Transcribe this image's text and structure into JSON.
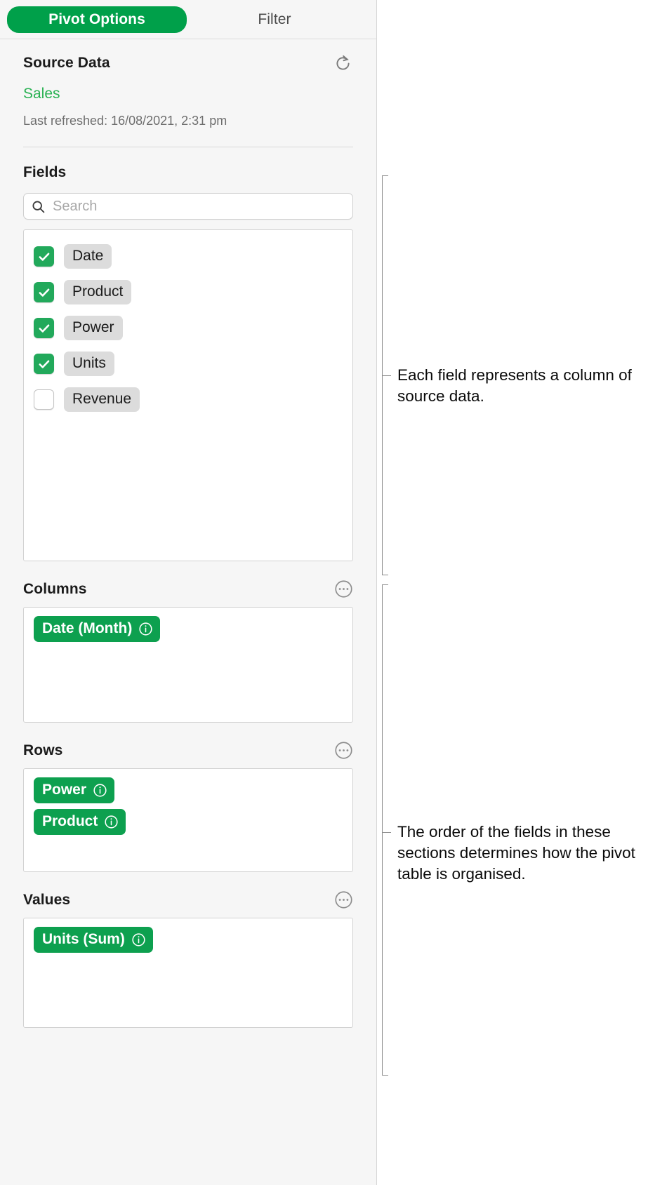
{
  "window": {
    "title": "Pivot Options"
  },
  "tabs": [
    {
      "label": "Pivot Options",
      "active": true
    },
    {
      "label": "Filter",
      "active": false
    }
  ],
  "source": {
    "heading": "Source Data",
    "table_name": "Sales",
    "last_refreshed": "Last refreshed: 16/08/2021, 2:31 pm",
    "refresh_icon": "refresh-icon"
  },
  "fields": {
    "heading": "Fields",
    "search": {
      "placeholder": "Search",
      "value": "",
      "icon": "search-icon"
    },
    "items": [
      {
        "label": "Date",
        "checked": true
      },
      {
        "label": "Product",
        "checked": true
      },
      {
        "label": "Power",
        "checked": true
      },
      {
        "label": "Units",
        "checked": true
      },
      {
        "label": "Revenue",
        "checked": false
      }
    ]
  },
  "zones": [
    {
      "heading": "Columns",
      "menu_icon": "ellipsis-circle-icon",
      "pills": [
        {
          "label": "Date (Month)",
          "info_icon": "info-icon"
        }
      ]
    },
    {
      "heading": "Rows",
      "menu_icon": "ellipsis-circle-icon",
      "pills": [
        {
          "label": "Power",
          "info_icon": "info-icon"
        },
        {
          "label": "Product",
          "info_icon": "info-icon"
        }
      ]
    },
    {
      "heading": "Values",
      "menu_icon": "ellipsis-circle-icon",
      "pills": [
        {
          "label": "Units (Sum)",
          "info_icon": "info-icon"
        }
      ]
    }
  ],
  "callouts": [
    {
      "text": "Each field represents a column of source data."
    },
    {
      "text": "The order of the fields in these sections determines how the pivot table is organised."
    }
  ],
  "colors": {
    "accent_green": "#00a04a",
    "pill_green": "#0da04f",
    "checkbox_green": "#22a95b",
    "link_green": "#28b152",
    "panel_bg": "#f6f6f6",
    "tag_grey": "#dcdcdc"
  }
}
